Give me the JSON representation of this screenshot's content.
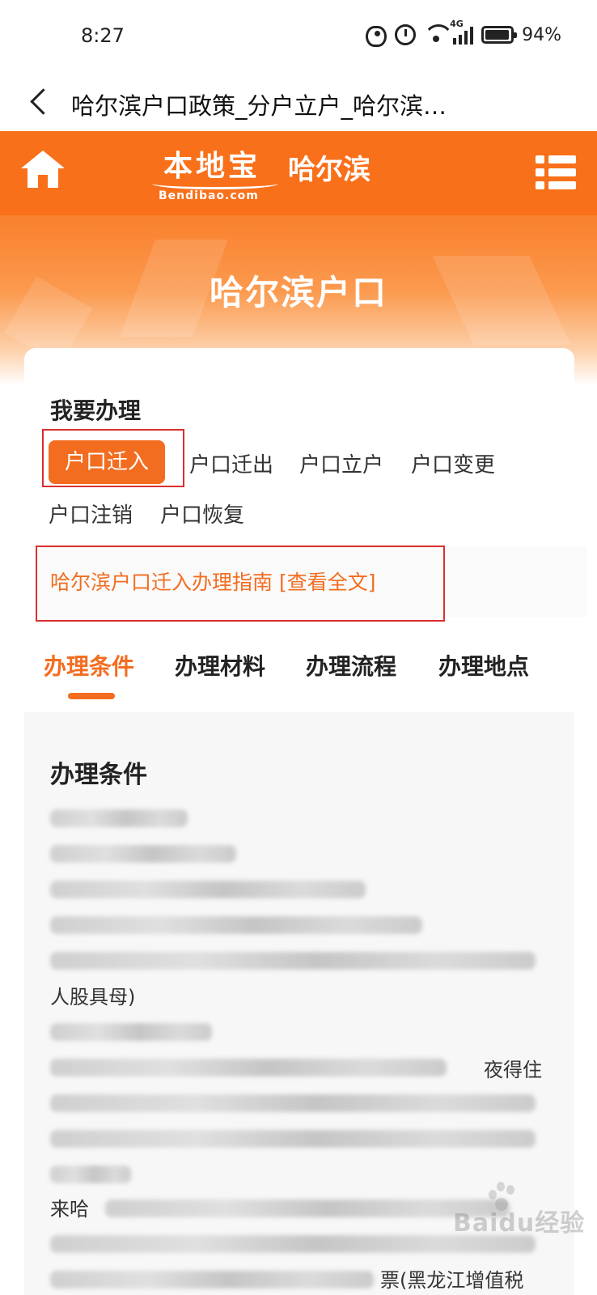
{
  "status_bar": {
    "time": "8:27",
    "network": "4G",
    "battery": "94%"
  },
  "title_bar": {
    "title": "哈尔滨户口政策_分户立户_哈尔滨…"
  },
  "header": {
    "logo_text": "本地宝",
    "logo_sub": "Bendibao.com",
    "city": "哈尔滨"
  },
  "banner": {
    "title": "哈尔滨户口"
  },
  "handle": {
    "heading": "我要办理",
    "tags": [
      "户口迁入",
      "户口迁出",
      "户口立户",
      "户口变更",
      "户口注销",
      "户口恢复"
    ],
    "active_tag": "户口迁入"
  },
  "guide": {
    "link": "哈尔滨户口迁入办理指南 [查看全文]"
  },
  "tabs": [
    "办理条件",
    "办理材料",
    "办理流程",
    "办理地点"
  ],
  "content": {
    "title": "办理条件",
    "partial_1": "人股具母)",
    "partial_2": "夜得住",
    "partial_3": "来哈",
    "partial_4": "票(黑龙江增值税"
  },
  "watermark": "Baidu经验",
  "colors": {
    "accent": "#f36d20",
    "header": "#f9701a",
    "highlight_box": "#d93030"
  }
}
